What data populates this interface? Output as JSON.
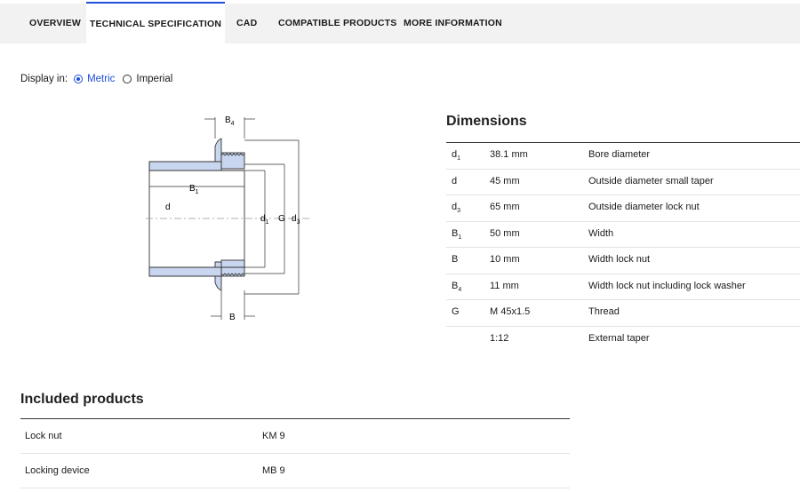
{
  "tabs": [
    {
      "label": "OVERVIEW",
      "active": false
    },
    {
      "label": "TECHNICAL SPECIFICATION",
      "active": true
    },
    {
      "label": "CAD",
      "active": false
    },
    {
      "label": "COMPATIBLE PRODUCTS",
      "active": false
    },
    {
      "label": "MORE INFORMATION",
      "active": false
    }
  ],
  "display": {
    "label": "Display in:",
    "metric": "Metric",
    "imperial": "Imperial",
    "selected": "Metric"
  },
  "drawing_labels": {
    "b4": "B",
    "b4_sub": "4",
    "b1": "B",
    "b1_sub": "1",
    "d": "d",
    "d1": "d",
    "d1_sub": "1",
    "g": "G",
    "d3": "d",
    "d3_sub": "3",
    "b": "B"
  },
  "dimensions": {
    "title": "Dimensions",
    "rows": [
      {
        "sym": "d",
        "sub": "1",
        "value": "38.1 mm",
        "desc": "Bore diameter"
      },
      {
        "sym": "d",
        "sub": "",
        "value": "45 mm",
        "desc": "Outside diameter small taper"
      },
      {
        "sym": "d",
        "sub": "3",
        "value": "65 mm",
        "desc": "Outside diameter lock nut"
      },
      {
        "sym": "B",
        "sub": "1",
        "value": "50 mm",
        "desc": "Width"
      },
      {
        "sym": "B",
        "sub": "",
        "value": "10 mm",
        "desc": "Width lock nut"
      },
      {
        "sym": "B",
        "sub": "4",
        "value": "11 mm",
        "desc": "Width lock nut including lock washer"
      },
      {
        "sym": "G",
        "sub": "",
        "value": "M 45x1.5",
        "desc": "Thread"
      },
      {
        "sym": "",
        "sub": "",
        "value": "1:12",
        "desc": "External taper"
      }
    ]
  },
  "included": {
    "title": "Included products",
    "rows": [
      {
        "name": "Lock nut",
        "code": "KM 9"
      },
      {
        "name": "Locking device",
        "code": "MB 9"
      }
    ]
  },
  "colors": {
    "accent": "#1d4ed8",
    "part_fill": "#c9d6ef",
    "line": "#333333"
  }
}
